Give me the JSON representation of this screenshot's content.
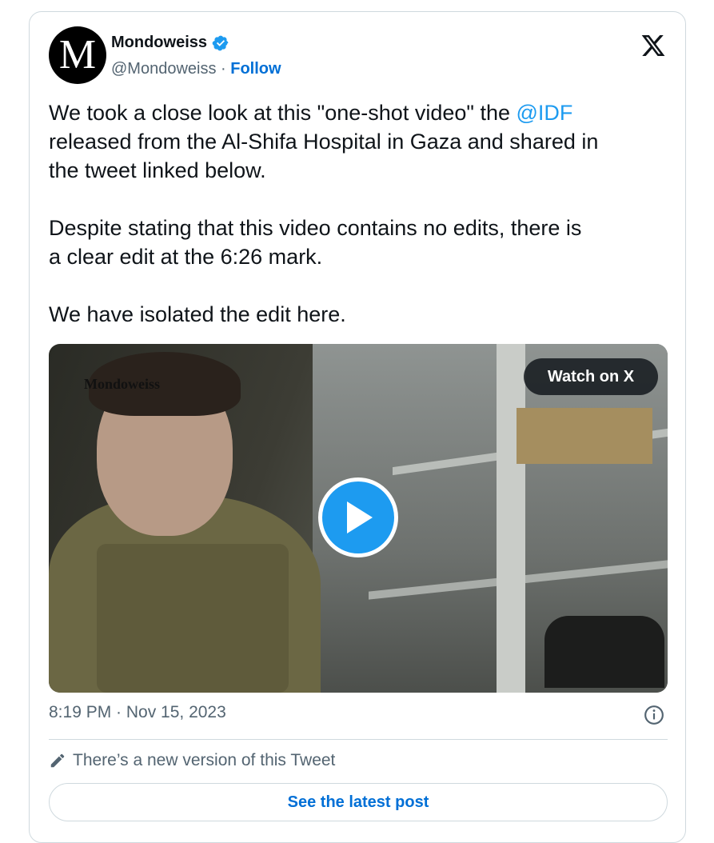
{
  "author": {
    "name": "Mondoweiss",
    "avatar_letter": "M",
    "handle": "@Mondoweiss",
    "separator": " · ",
    "follow_label": "Follow"
  },
  "tweet": {
    "text_part1": "We took a close look at this \"one-shot video\" the ",
    "mention": "@IDF",
    "text_part2": "\nreleased from the Al-Shifa Hospital in Gaza and shared in\nthe tweet linked below.\n\nDespite stating that this video contains no edits, there is\na clear edit at the 6:26 mark.\n\nWe have isolated the edit here."
  },
  "media": {
    "watermark": "Mondoweiss",
    "watch_label": "Watch on X"
  },
  "meta": {
    "timestamp": "8:19 PM · Nov 15, 2023"
  },
  "notice": {
    "new_version_text": "There’s a new version of this Tweet",
    "latest_button_label": "See the latest post"
  },
  "colors": {
    "link": "#1d9bf0",
    "follow": "#006fd6",
    "muted": "#536471"
  }
}
